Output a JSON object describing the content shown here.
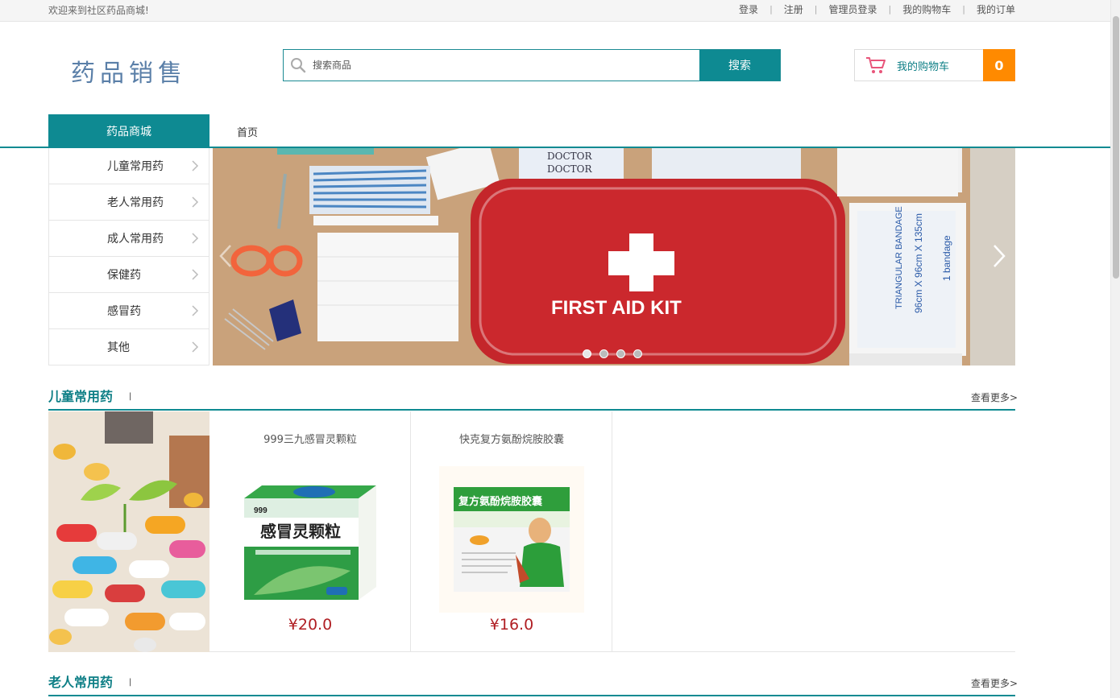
{
  "topbar": {
    "welcome": "欢迎来到社区药品商城!",
    "links": [
      "登录",
      "注册",
      "管理员登录",
      "我的购物车",
      "我的订单"
    ]
  },
  "header": {
    "logo": "药品销售",
    "search_placeholder": "搜索商品",
    "search_button": "搜索",
    "cart_label": "我的购物车",
    "cart_count": "0"
  },
  "nav": {
    "main": "药品商城",
    "home": "首页"
  },
  "categories": [
    "儿童常用药",
    "老人常用药",
    "成人常用药",
    "保健药",
    "感冒药",
    "其他"
  ],
  "banner": {
    "kit_text": "FIRST AID KIT",
    "slide_count": 4,
    "active_slide": 1
  },
  "sections": [
    {
      "title": "儿童常用药",
      "divider": "|",
      "more": "查看更多>",
      "products": [
        {
          "name": "999三九感冒灵颗粒",
          "price": "¥20.0"
        },
        {
          "name": "快克复方氨酚烷胺胶囊",
          "price": "¥16.0"
        }
      ]
    },
    {
      "title": "老人常用药",
      "divider": "|",
      "more": "查看更多>"
    }
  ],
  "colors": {
    "accent": "#0e8a92",
    "cart_count_bg": "#ff8a00",
    "price": "#b01e23"
  }
}
